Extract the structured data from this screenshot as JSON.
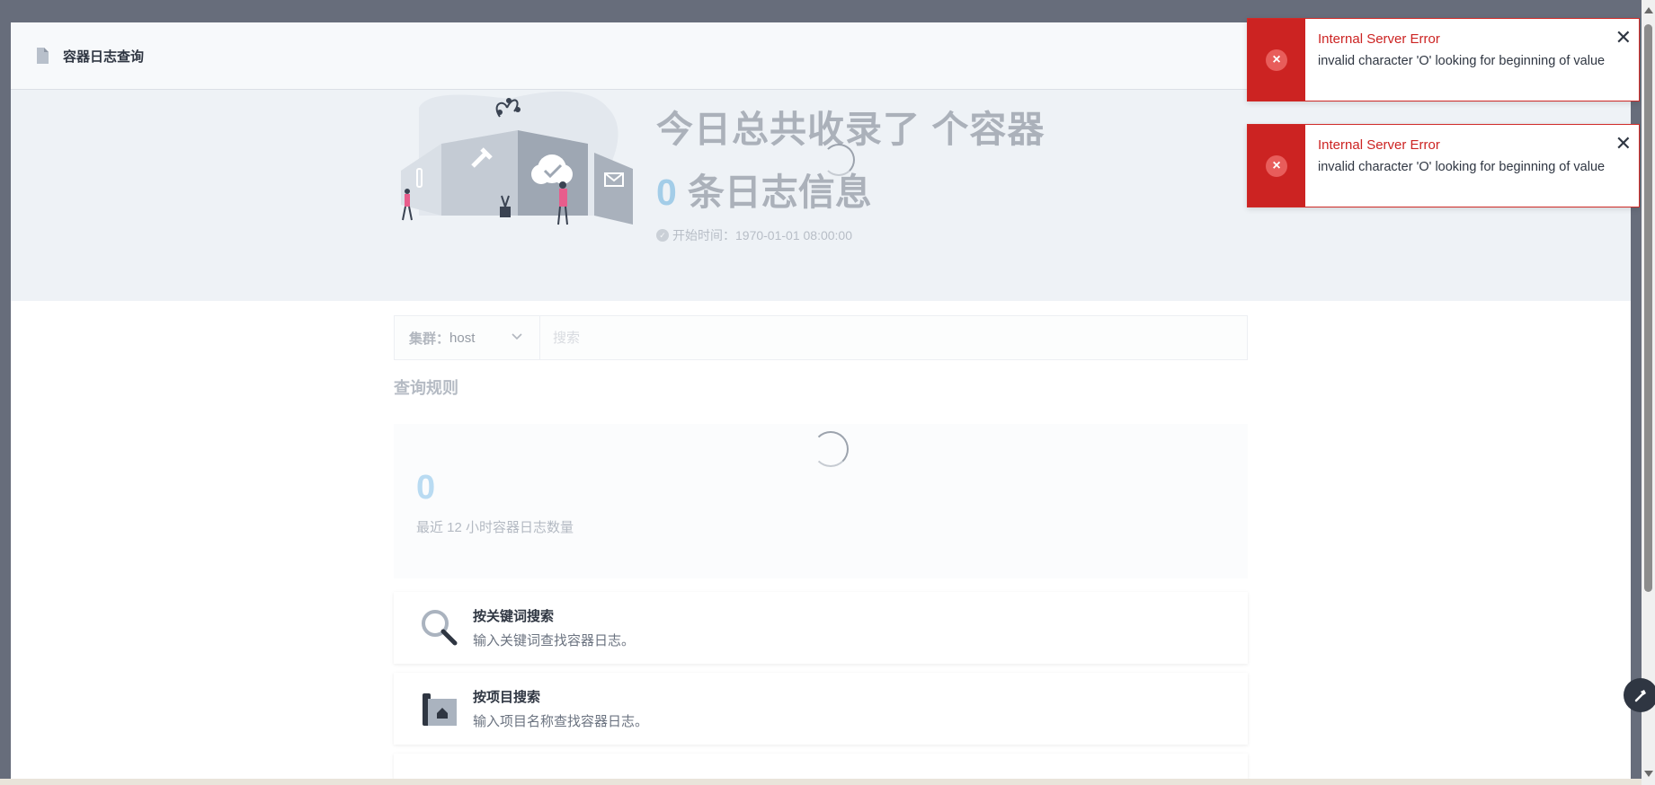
{
  "modal": {
    "title": "容器日志查询"
  },
  "banner": {
    "title": "今日总共收录了 个容器",
    "log_count": "0",
    "log_suffix": "条日志信息",
    "start_time_label": "开始时间：",
    "start_time_value": "1970-01-01 08:00:00"
  },
  "search": {
    "cluster_label": "集群：",
    "cluster_value": "host",
    "placeholder": "搜索"
  },
  "rules": {
    "title": "查询规则"
  },
  "stat": {
    "count": "0",
    "label": "最近 12 小时容器日志数量"
  },
  "actions": [
    {
      "title": "按关键词搜索",
      "desc": "输入关键词查找容器日志。",
      "icon": "magnifier-icon"
    },
    {
      "title": "按项目搜索",
      "desc": "输入项目名称查找容器日志。",
      "icon": "project-icon"
    }
  ],
  "toasts": [
    {
      "title": "Internal Server Error",
      "message": "invalid character 'O' looking for beginning of value"
    },
    {
      "title": "Internal Server Error",
      "message": "invalid character 'O' looking for beginning of value"
    }
  ],
  "colors": {
    "error": "#cc2322",
    "accent": "#3e9bd6",
    "overlay": "#676d7b"
  }
}
